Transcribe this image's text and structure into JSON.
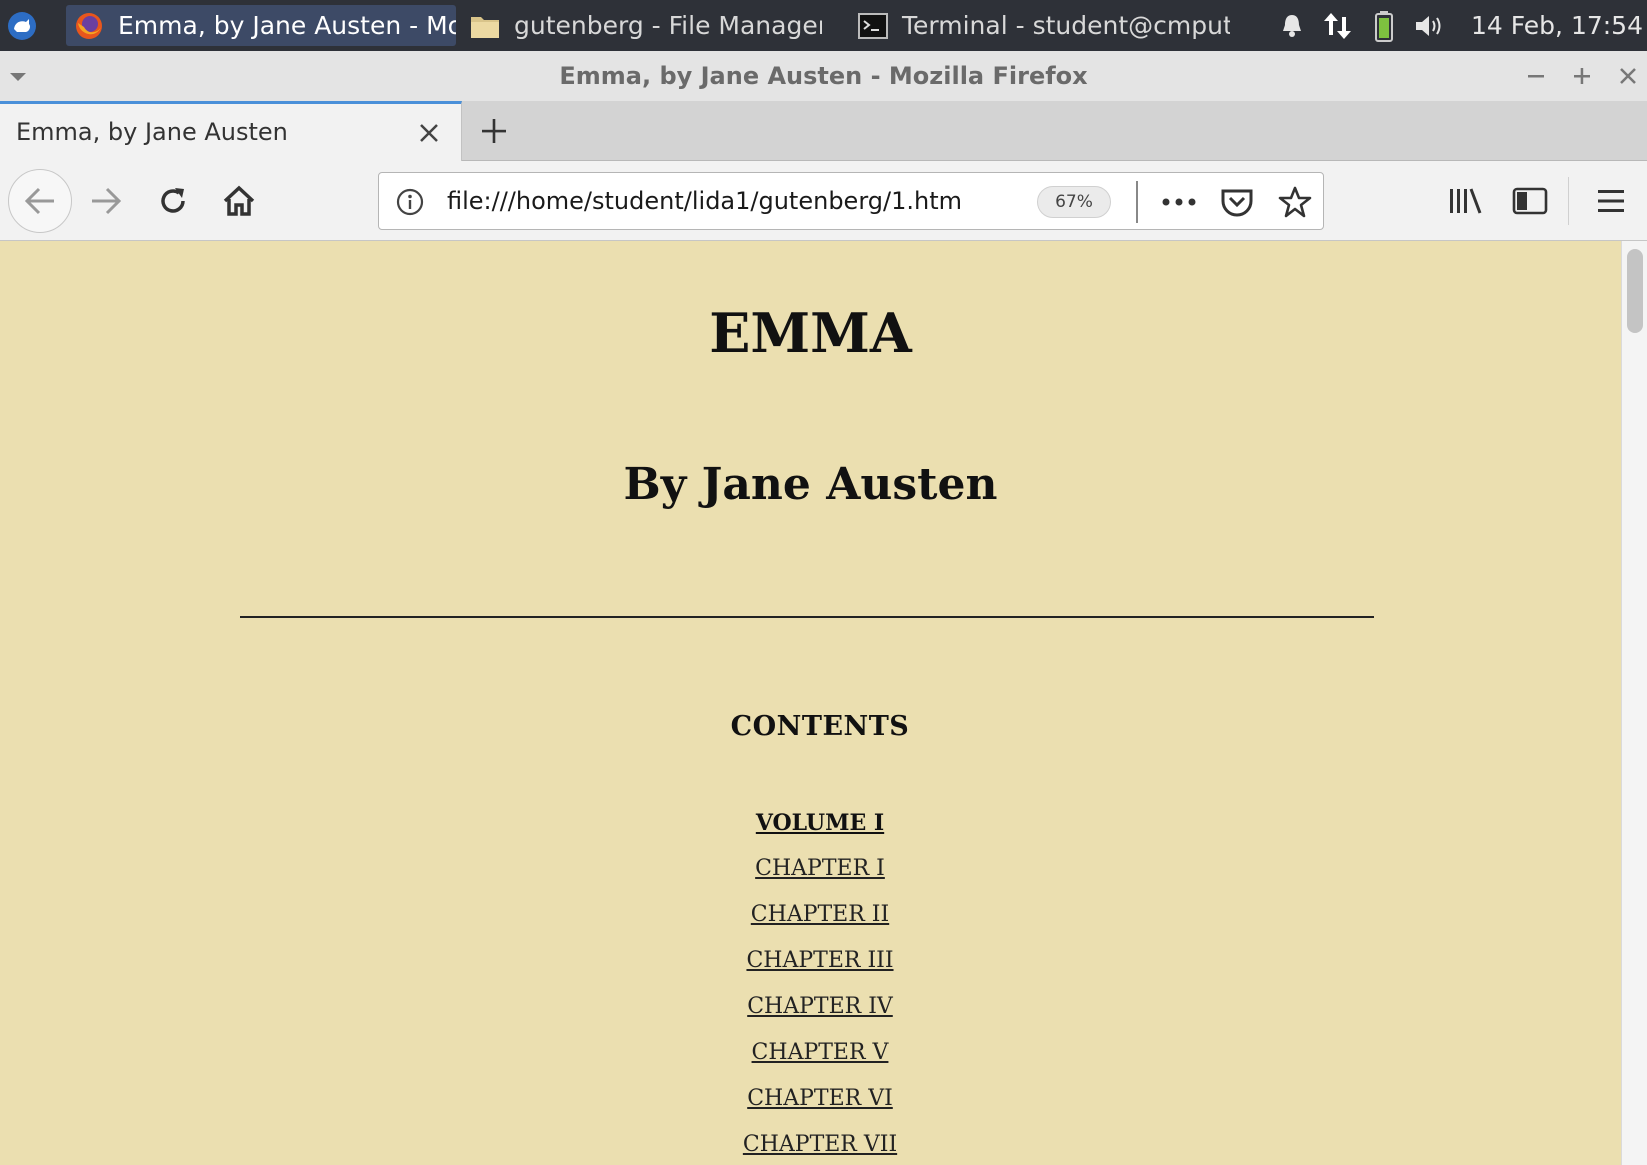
{
  "panel": {
    "tasks": [
      {
        "label": "Emma, by Jane Austen - Mo...",
        "icon": "firefox-icon",
        "active": true
      },
      {
        "label": "gutenberg - File Manager",
        "icon": "folder-icon",
        "active": false
      },
      {
        "label": "Terminal - student@cmput...",
        "icon": "terminal-icon",
        "active": false
      }
    ],
    "clock": "14 Feb, 17:54"
  },
  "window": {
    "title": "Emma, by Jane Austen - Mozilla Firefox"
  },
  "browser": {
    "tab_title": "Emma, by Jane Austen",
    "url": "file:///home/student/lida1/gutenberg/1.htm",
    "zoom": "67%"
  },
  "page": {
    "title": "EMMA",
    "author": "By Jane Austen",
    "contents_heading": "CONTENTS",
    "toc": [
      {
        "label": "VOLUME I",
        "kind": "volume"
      },
      {
        "label": "CHAPTER I",
        "kind": "chapter"
      },
      {
        "label": "CHAPTER II",
        "kind": "chapter"
      },
      {
        "label": "CHAPTER III",
        "kind": "chapter"
      },
      {
        "label": "CHAPTER IV",
        "kind": "chapter"
      },
      {
        "label": "CHAPTER V",
        "kind": "chapter"
      },
      {
        "label": "CHAPTER VI",
        "kind": "chapter"
      },
      {
        "label": "CHAPTER VII",
        "kind": "chapter"
      }
    ]
  },
  "colors": {
    "page_background": "#ebdfb0",
    "panel_background": "#2e3138",
    "active_task": "#3d4a66",
    "tab_accent": "#4a90d9"
  }
}
